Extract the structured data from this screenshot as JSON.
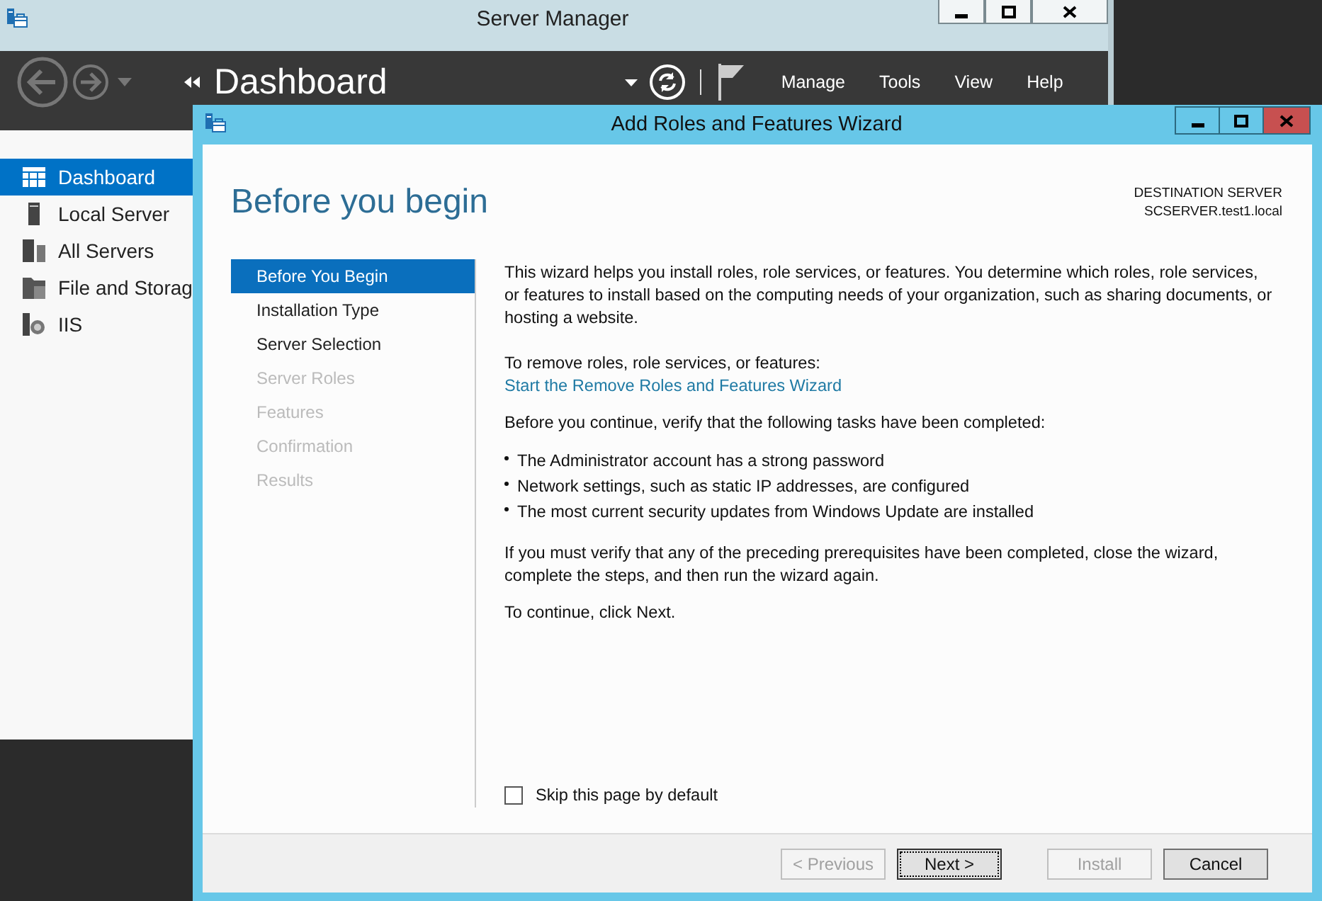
{
  "server_manager": {
    "title": "Server Manager",
    "nav_title": "Dashboard",
    "menu": [
      "Manage",
      "Tools",
      "View",
      "Help"
    ],
    "sidebar": {
      "items": [
        {
          "label": "Dashboard",
          "selected": true
        },
        {
          "label": "Local Server",
          "selected": false
        },
        {
          "label": "All Servers",
          "selected": false
        },
        {
          "label": "File and Storag",
          "selected": false
        },
        {
          "label": "IIS",
          "selected": false
        }
      ]
    }
  },
  "wizard": {
    "title": "Add Roles and Features Wizard",
    "heading": "Before you begin",
    "destination_label": "DESTINATION SERVER",
    "destination_server": "SCSERVER.test1.local",
    "steps": [
      {
        "label": "Before You Begin",
        "selected": true,
        "disabled": false
      },
      {
        "label": "Installation Type",
        "selected": false,
        "disabled": false
      },
      {
        "label": "Server Selection",
        "selected": false,
        "disabled": false
      },
      {
        "label": "Server Roles",
        "selected": false,
        "disabled": true
      },
      {
        "label": "Features",
        "selected": false,
        "disabled": true
      },
      {
        "label": "Confirmation",
        "selected": false,
        "disabled": true
      },
      {
        "label": "Results",
        "selected": false,
        "disabled": true
      }
    ],
    "intro": "This wizard helps you install roles, role services, or features. You determine which roles, role services, or features to install based on the computing needs of your organization, such as sharing documents, or hosting a website.",
    "remove_label": "To remove roles, role services, or features:",
    "remove_link": "Start the Remove Roles and Features Wizard",
    "verify_text": "Before you continue, verify that the following tasks have been completed:",
    "bullets": [
      "The Administrator account has a strong password",
      "Network settings, such as static IP addresses, are configured",
      "The most current security updates from Windows Update are installed"
    ],
    "prereq_text": "If you must verify that any of the preceding prerequisites have been completed, close the wizard, complete the steps, and then run the wizard again.",
    "continue_text": "To continue, click Next.",
    "skip_checkbox": {
      "label": "Skip this page by default",
      "checked": false
    },
    "buttons": [
      {
        "label": "< Previous",
        "disabled": true,
        "focused": false
      },
      {
        "label": "Next >",
        "disabled": false,
        "focused": true
      },
      {
        "label": "Install",
        "disabled": true,
        "focused": false
      },
      {
        "label": "Cancel",
        "disabled": false,
        "focused": false
      }
    ]
  }
}
